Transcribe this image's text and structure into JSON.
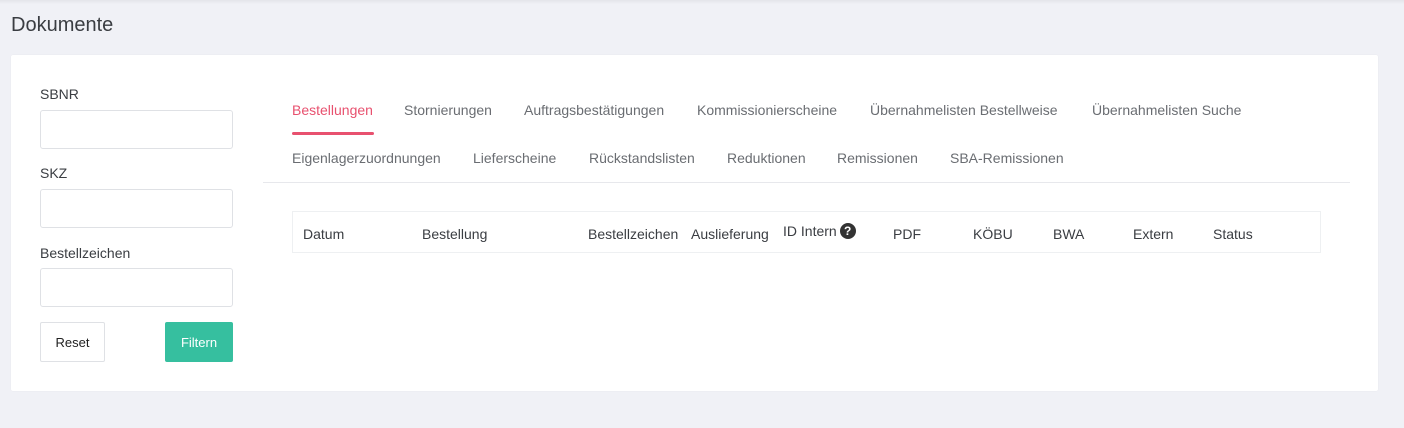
{
  "page": {
    "title": "Dokumente"
  },
  "filters": {
    "fields": [
      {
        "label": "SBNR",
        "value": "",
        "placeholder": ""
      },
      {
        "label": "SKZ",
        "value": "",
        "placeholder": ""
      },
      {
        "label": "Bestellzeichen",
        "value": "",
        "placeholder": ""
      }
    ],
    "reset_label": "Reset",
    "filter_label": "Filtern"
  },
  "tabs": [
    {
      "label": "Bestellungen",
      "active": true
    },
    {
      "label": "Stornierungen"
    },
    {
      "label": "Auftragsbestätigungen"
    },
    {
      "label": "Kommissionierscheine"
    },
    {
      "label": "Übernahmelisten Bestellweise"
    },
    {
      "label": "Übernahmelisten Suche"
    },
    {
      "label": "Eigenlagerzuordnungen"
    },
    {
      "label": "Lieferscheine"
    },
    {
      "label": "Rückstandslisten"
    },
    {
      "label": "Reduktionen"
    },
    {
      "label": "Remissionen"
    },
    {
      "label": "SBA-Remissionen"
    }
  ],
  "table": {
    "headers": [
      "Datum",
      "Bestellung",
      "Bestellzeichen",
      "Auslieferung",
      "ID Intern",
      "PDF",
      "KÖBU",
      "BWA",
      "Extern",
      "Status"
    ],
    "help_icon": "question-circle-icon",
    "rows": []
  },
  "colors": {
    "accent": "#e8516f",
    "primary_button": "#36bf9f",
    "background": "#f0f1f6"
  }
}
